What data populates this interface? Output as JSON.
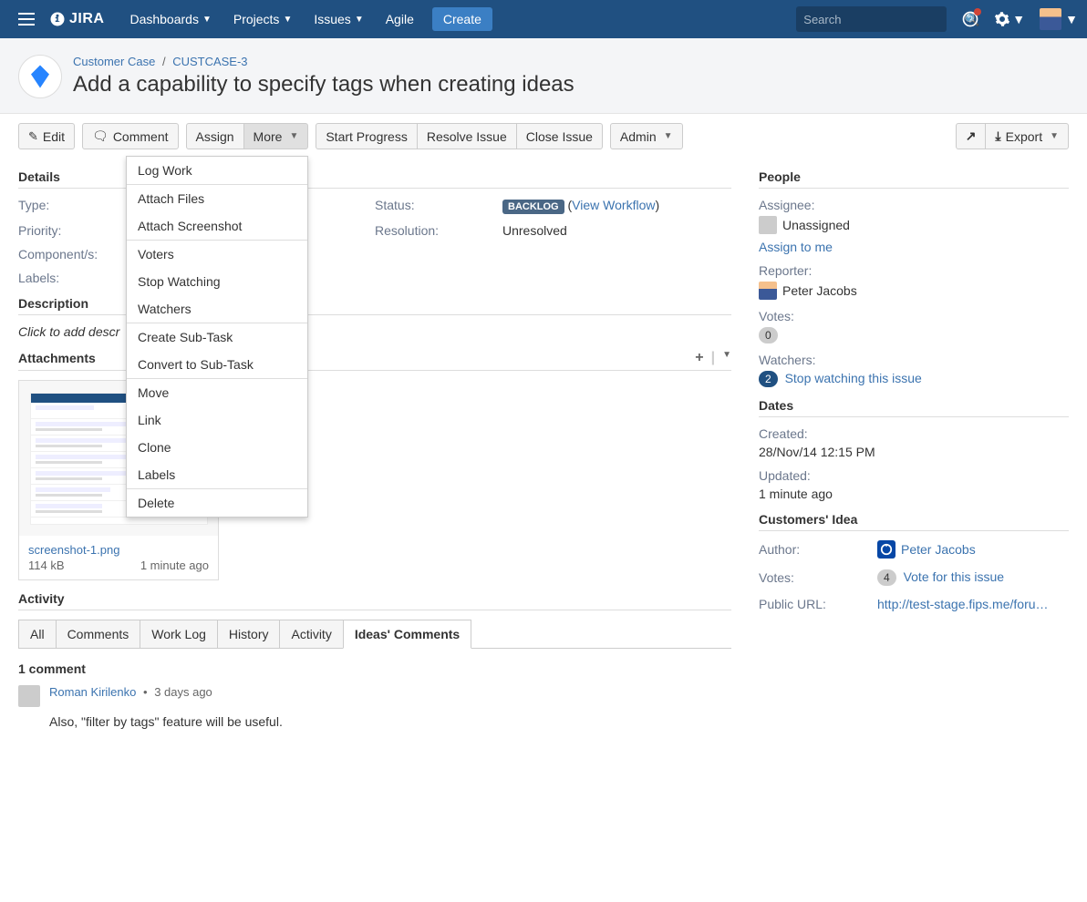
{
  "nav": {
    "dashboards": "Dashboards",
    "projects": "Projects",
    "issues": "Issues",
    "agile": "Agile",
    "create": "Create",
    "search_placeholder": "Search"
  },
  "breadcrumb": {
    "project": "Customer Case",
    "issue_key": "CUSTCASE-3"
  },
  "issue_title": "Add a capability to specify tags when creating ideas",
  "toolbar": {
    "edit": "Edit",
    "comment": "Comment",
    "assign": "Assign",
    "more": "More",
    "start_progress": "Start Progress",
    "resolve": "Resolve Issue",
    "close": "Close Issue",
    "admin": "Admin",
    "export": "Export"
  },
  "more_menu": {
    "log_work": "Log Work",
    "attach_files": "Attach Files",
    "attach_screenshot": "Attach Screenshot",
    "voters": "Voters",
    "stop_watching": "Stop Watching",
    "watchers": "Watchers",
    "create_subtask": "Create Sub-Task",
    "convert_subtask": "Convert to Sub-Task",
    "move": "Move",
    "link": "Link",
    "clone": "Clone",
    "labels": "Labels",
    "delete": "Delete"
  },
  "sections": {
    "details": "Details",
    "description": "Description",
    "attachments": "Attachments",
    "activity": "Activity",
    "people": "People",
    "dates": "Dates",
    "customers_idea": "Customers' Idea"
  },
  "details": {
    "type_label": "Type:",
    "priority_label": "Priority:",
    "components_label": "Component/s:",
    "labels_label": "Labels:",
    "status_label": "Status:",
    "status_value": "BACKLOG",
    "view_workflow": "View Workflow",
    "resolution_label": "Resolution:",
    "resolution_value": "Unresolved"
  },
  "description_placeholder": "Click to add descr",
  "attachment": {
    "filename": "screenshot-1.png",
    "size": "114 kB",
    "time": "1 minute ago"
  },
  "tabs": {
    "all": "All",
    "comments": "Comments",
    "worklog": "Work Log",
    "history": "History",
    "activity": "Activity",
    "ideas_comments": "Ideas' Comments"
  },
  "comments_count": "1 comment",
  "comment": {
    "author": "Roman Kirilenko",
    "time": "3 days ago",
    "body": "Also, \"filter by tags\" feature will be useful."
  },
  "people": {
    "assignee_label": "Assignee:",
    "assignee_value": "Unassigned",
    "assign_to_me": "Assign to me",
    "reporter_label": "Reporter:",
    "reporter_value": "Peter Jacobs",
    "votes_label": "Votes:",
    "votes_value": "0",
    "watchers_label": "Watchers:",
    "watchers_value": "2",
    "stop_watching": "Stop watching this issue"
  },
  "dates": {
    "created_label": "Created:",
    "created_value": "28/Nov/14 12:15 PM",
    "updated_label": "Updated:",
    "updated_value": "1 minute ago"
  },
  "idea": {
    "author_label": "Author:",
    "author_value": "Peter Jacobs",
    "votes_label": "Votes:",
    "votes_value": "4",
    "vote_link": "Vote for this issue",
    "url_label": "Public URL:",
    "url_value": "http://test-stage.fips.me/foru…"
  }
}
